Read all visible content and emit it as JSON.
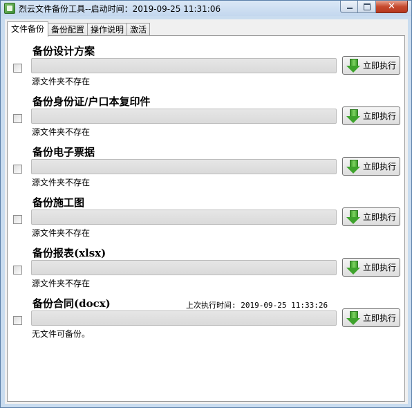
{
  "window": {
    "title": "烈云文件备份工具--启动时间：2019-09-25 11:31:06",
    "close_label": "✕"
  },
  "tabs": [
    {
      "label": "文件备份"
    },
    {
      "label": "备份配置"
    },
    {
      "label": "操作说明"
    },
    {
      "label": "激活"
    }
  ],
  "tasks": [
    {
      "title": "备份设计方案",
      "status": "源文件夹不存在",
      "button": "立即执行",
      "last_run": ""
    },
    {
      "title": "备份身份证/户口本复印件",
      "status": "源文件夹不存在",
      "button": "立即执行",
      "last_run": ""
    },
    {
      "title": "备份电子票据",
      "status": "源文件夹不存在",
      "button": "立即执行",
      "last_run": ""
    },
    {
      "title": "备份施工图",
      "status": "源文件夹不存在",
      "button": "立即执行",
      "last_run": ""
    },
    {
      "title": "备份报表(xlsx)",
      "status": "源文件夹不存在",
      "button": "立即执行",
      "last_run": ""
    },
    {
      "title": "备份合同(docx)",
      "status": "无文件可备份。",
      "button": "立即执行",
      "last_run": "上次执行时间: 2019-09-25 11:33:26"
    }
  ],
  "colors": {
    "accent_green": "#3ea32c",
    "titlebar": "#c9dcef",
    "close_red": "#c64a2f"
  },
  "icons": {
    "app": "app-icon",
    "execute": "download-arrow-icon"
  }
}
